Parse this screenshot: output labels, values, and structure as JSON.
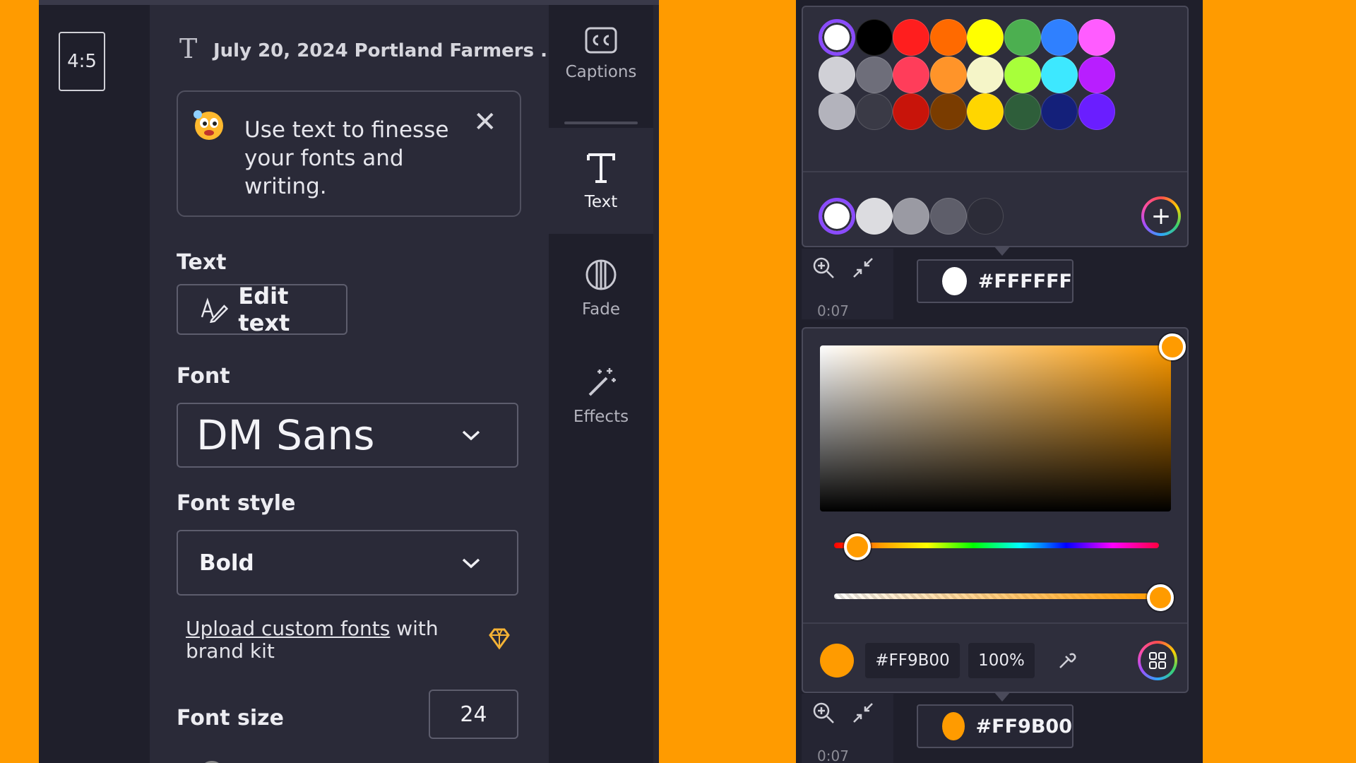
{
  "editor": {
    "aspect_ratio": "4:5",
    "header_title": "July 20, 2024 Portland Farmers ...",
    "tip": {
      "message": "Use text to finesse your fonts and writing."
    },
    "text_section": {
      "label": "Text",
      "edit_button": "Edit text"
    },
    "font_section": {
      "label": "Font",
      "value": "DM Sans"
    },
    "font_style_section": {
      "label": "Font style",
      "value": "Bold"
    },
    "upload": {
      "link_text": "Upload custom fonts",
      "rest_text": " with brand kit"
    },
    "font_size": {
      "label": "Font size",
      "value": "24"
    }
  },
  "side_tabs": [
    {
      "label": "Captions",
      "icon": "captions-icon"
    },
    {
      "label": "Text",
      "icon": "text-icon",
      "active": true
    },
    {
      "label": "Fade",
      "icon": "fade-icon"
    },
    {
      "label": "Effects",
      "icon": "magic-wand-icon"
    }
  ],
  "palette": {
    "rows": [
      [
        "#FFFFFF",
        "#000000",
        "#FF1E1E",
        "#FF6A00",
        "#FFFF00",
        "#4CAF50",
        "#2F80FF",
        "#FF5CFF"
      ],
      [
        "#D0D0D6",
        "#6E6E7A",
        "#FF3D5A",
        "#FF9429",
        "#F5F5C8",
        "#A8FF3A",
        "#3DE8FF",
        "#B81EFF"
      ],
      [
        "#B3B3BC",
        "#3A3A46",
        "#C8140A",
        "#7A3C00",
        "#FFD600",
        "#2E5E3A",
        "#14207A",
        "#6A1EFF"
      ]
    ],
    "selected": "#FFFFFF",
    "neutrals": [
      "#FFFFFF",
      "#DCDCE0",
      "#9A9AA3",
      "#5E5E6A",
      "#2C2C38"
    ]
  },
  "color_chip_top": {
    "value": "#FFFFFF",
    "color": "#FFFFFF"
  },
  "color_chip_bottom": {
    "value": "#FF9B00",
    "color": "#FF9B00"
  },
  "timecode": "0:07",
  "picker": {
    "color": "#FF9B00",
    "hex": "#FF9B00",
    "opacity": "100%",
    "hue_fraction": 0.08,
    "alpha_fraction": 1.0
  },
  "colors": {
    "background": "#FF9B00",
    "panel": "#2A2A38",
    "accent": "#8A4BFF"
  }
}
